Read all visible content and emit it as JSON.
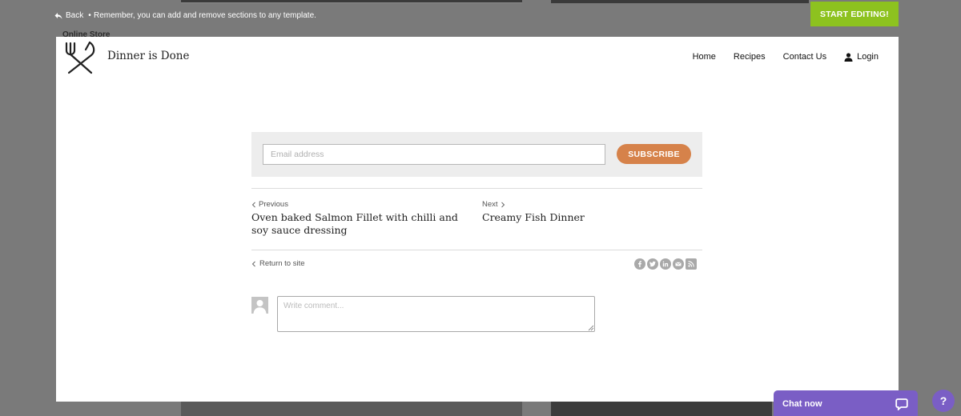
{
  "editor_bar": {
    "back_label": "Back",
    "separator": "•",
    "hint": "Remember, you can add and remove sections to any template.",
    "start_button": "START EDITING!"
  },
  "background": {
    "ghost_label": "Online Store"
  },
  "site": {
    "title": "Dinner is Done",
    "nav": [
      {
        "label": "Home"
      },
      {
        "label": "Recipes"
      },
      {
        "label": "Contact Us"
      },
      {
        "label": "Login"
      }
    ]
  },
  "subscribe": {
    "email_placeholder": "Email address",
    "button_label": "SUBSCRIBE"
  },
  "post_nav": {
    "previous_label": "Previous",
    "previous_title": "Oven baked Salmon Fillet with chilli and soy sauce dressing",
    "next_label": "Next",
    "next_title": "Creamy Fish Dinner"
  },
  "return_label": "Return to site",
  "share_icons": [
    "facebook-icon",
    "twitter-icon",
    "linkedin-icon",
    "email-icon",
    "rss-icon"
  ],
  "comment": {
    "placeholder": "Write comment..."
  },
  "chat": {
    "label": "Chat now"
  },
  "help": {
    "label": "?"
  },
  "colors": {
    "accent_green": "#8dc21f",
    "subscribe_orange": "#d6824a",
    "chat_purple": "#7a5ec5"
  }
}
